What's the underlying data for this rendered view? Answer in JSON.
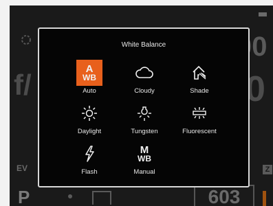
{
  "popup": {
    "title": "White Balance",
    "accent_color": "#e8601c",
    "selected": "Auto",
    "options": [
      {
        "label": "Auto",
        "icon": "auto-wb-icon",
        "glyph_top": "A",
        "glyph_bottom": "WB"
      },
      {
        "label": "Cloudy",
        "icon": "cloud-icon"
      },
      {
        "label": "Shade",
        "icon": "shade-house-icon"
      },
      {
        "label": "Daylight",
        "icon": "sun-icon"
      },
      {
        "label": "Tungsten",
        "icon": "bulb-icon"
      },
      {
        "label": "Fluorescent",
        "icon": "fluorescent-tube-icon"
      },
      {
        "label": "Flash",
        "icon": "flash-bolt-icon"
      },
      {
        "label": "Manual",
        "icon": "manual-wb-icon",
        "glyph_top": "M",
        "glyph_bottom": "WB"
      }
    ]
  },
  "background": {
    "f_label": "f/",
    "top_value": "00",
    "right_value": "0",
    "ev_label": "EV",
    "iso_badge": "Z",
    "mode": "P",
    "shot_count": "603"
  }
}
